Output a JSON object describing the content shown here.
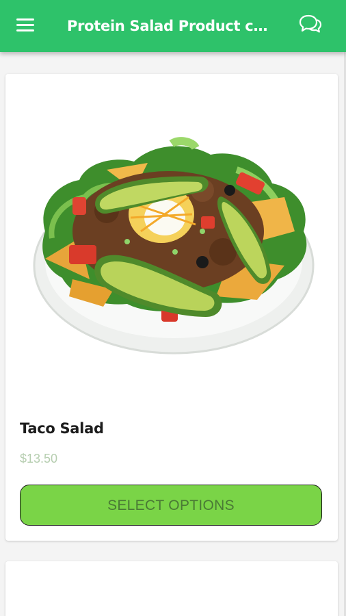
{
  "appbar": {
    "title": "Protein Salad Product cat...",
    "menu_icon": "hamburger-menu-icon",
    "chat_icon": "chat-bubbles-icon",
    "color": "#2ec26a"
  },
  "products": [
    {
      "name": "Taco Salad",
      "price": "$13.50",
      "button_label": "SELECT OPTIONS",
      "button_color": "#7ad447"
    }
  ]
}
